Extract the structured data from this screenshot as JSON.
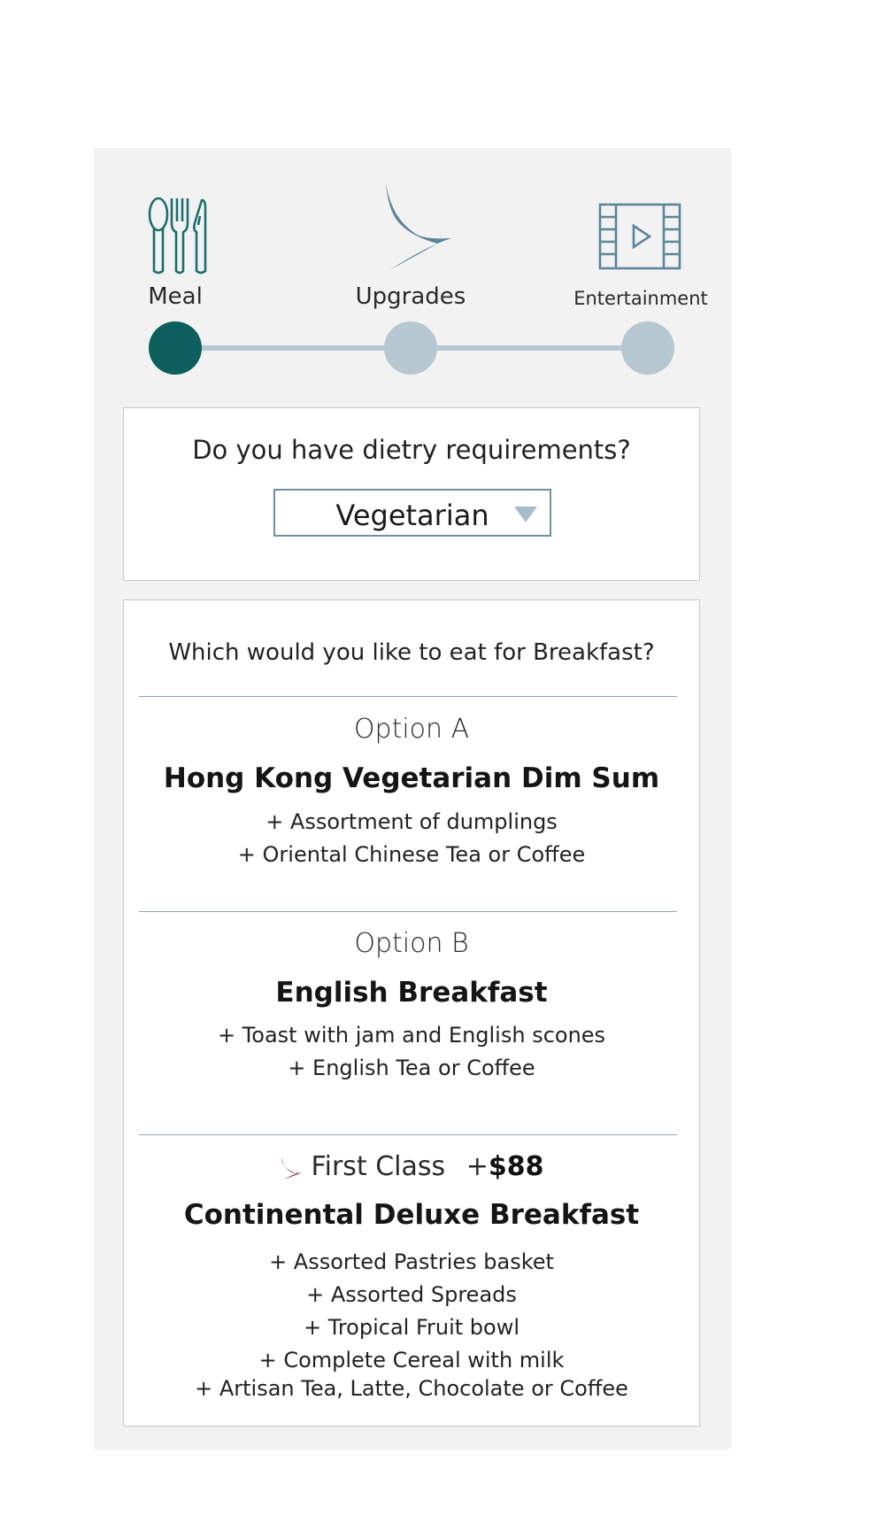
{
  "steps": [
    {
      "label": "Meal",
      "icon": "cutlery-icon",
      "active": true
    },
    {
      "label": "Upgrades",
      "icon": "airline-logo-icon",
      "active": false
    },
    {
      "label": "Entertainment",
      "icon": "film-play-icon",
      "active": false
    }
  ],
  "diet": {
    "question": "Do you have dietry requirements?",
    "selected": "Vegetarian"
  },
  "meal": {
    "question": "Which would you like to eat for Breakfast?",
    "options": [
      {
        "label": "Option A",
        "dish": "Hong Kong Vegetarian Dim Sum",
        "items": [
          "+ Assortment of dumplings",
          "+ Oriental Chinese Tea or Coffee"
        ]
      },
      {
        "label": "Option B",
        "dish": "English Breakfast",
        "items": [
          "+ Toast with jam and English scones",
          "+ English Tea or Coffee"
        ]
      }
    ],
    "first_class": {
      "label": "First Class",
      "price_prefix": "+",
      "price": "$88",
      "dish": "Continental Deluxe Breakfast",
      "items": [
        "+ Assorted Pastries basket",
        "+ Assorted Spreads",
        "+ Tropical Fruit bowl",
        "+ Complete Cereal with milk",
        "+ Artisan Tea, Latte, Chocolate or Coffee"
      ]
    }
  },
  "colors": {
    "panel_bg": "#f2f2f2",
    "active_dot": "#0c5f5c",
    "inactive_dot": "#b7c7d2",
    "icon_teal": "#1e6e6c",
    "icon_slate": "#5d8599",
    "first_class_icon": "#7a1f3f"
  }
}
